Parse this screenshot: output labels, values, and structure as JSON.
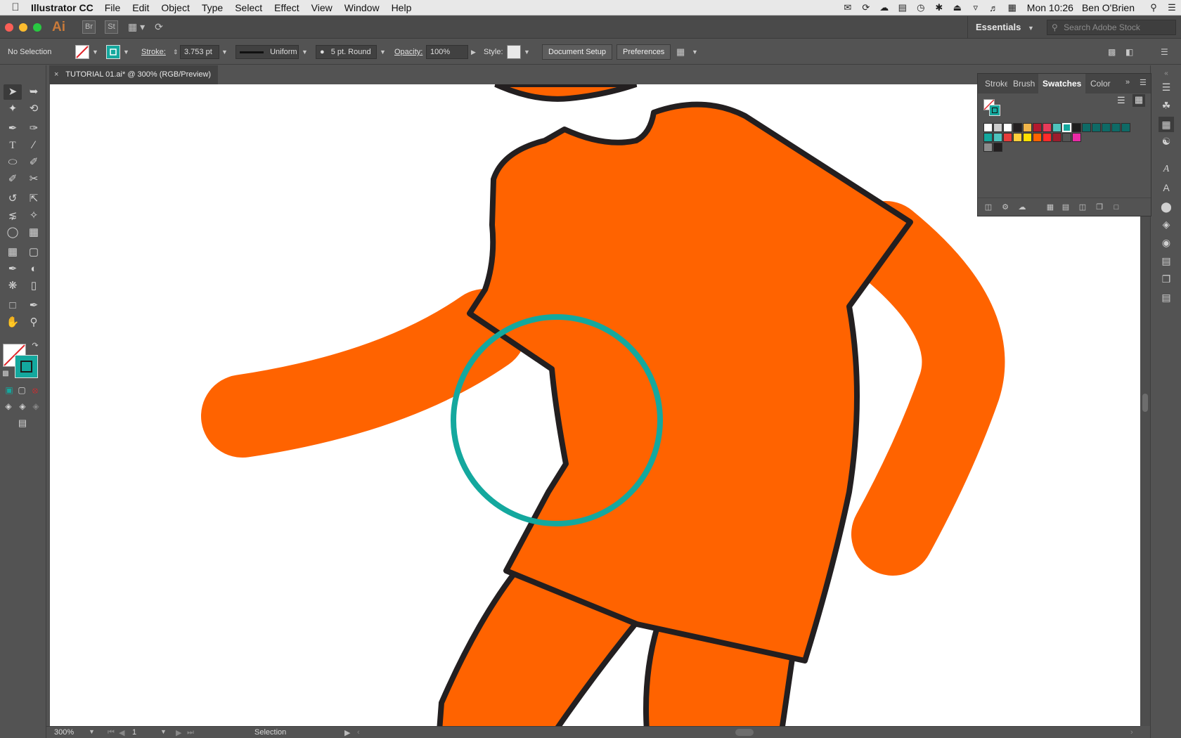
{
  "menubar": {
    "app_name": "Illustrator CC",
    "menus": [
      "File",
      "Edit",
      "Object",
      "Type",
      "Select",
      "Effect",
      "View",
      "Window",
      "Help"
    ],
    "clock": "Mon 10:26",
    "user": "Ben O'Brien"
  },
  "appbar": {
    "logo": "Ai",
    "bridge": "Br",
    "stock": "St",
    "workspace": "Essentials",
    "search_placeholder": "Search Adobe Stock"
  },
  "control": {
    "selection": "No Selection",
    "stroke_label": "Stroke:",
    "stroke_value": "3.753 pt",
    "profile": "Uniform",
    "brush": "5 pt. Round",
    "opacity_label": "Opacity:",
    "opacity_value": "100%",
    "style_label": "Style:",
    "document_setup": "Document Setup",
    "preferences": "Preferences"
  },
  "document": {
    "tab_title": "TUTORIAL 01.ai* @ 300% (RGB/Preview)",
    "close": "×"
  },
  "status": {
    "zoom": "300%",
    "page": "1",
    "tool": "Selection"
  },
  "panel": {
    "tabs": [
      "Stroke",
      "Brush",
      "Swatches",
      "Color"
    ],
    "active_tab": "Swatches"
  },
  "colors": {
    "orange": "#ff6300",
    "teal": "#14a89e",
    "outline": "#231f20"
  }
}
